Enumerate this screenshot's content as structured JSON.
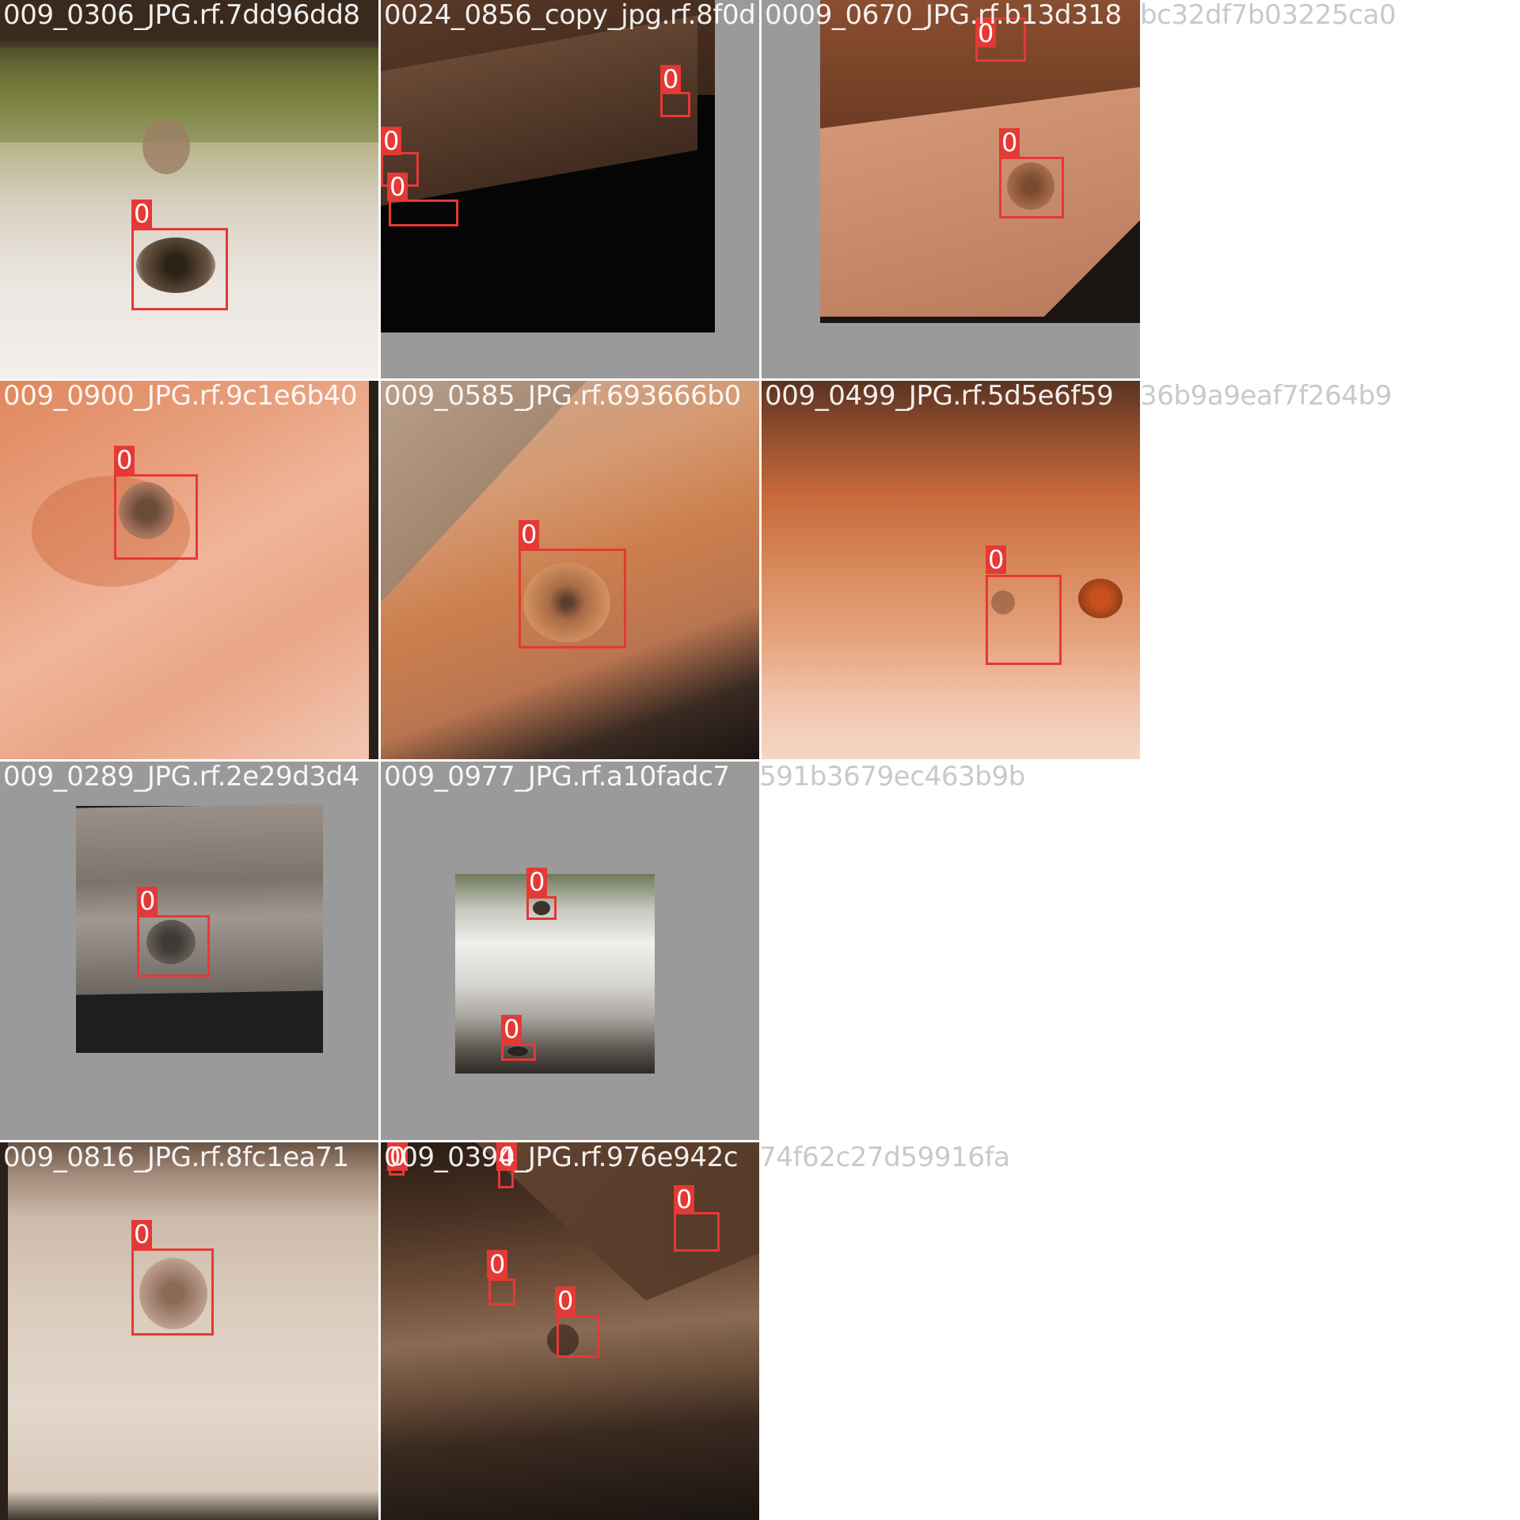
{
  "tiles": [
    {
      "title": "009_0306_JPG.rf.7dd96dd8",
      "labels": [
        "0"
      ]
    },
    {
      "title": "0024_0856_copy_jpg.rf.8f0d",
      "labels": [
        "0",
        "0",
        "0"
      ]
    },
    {
      "title": "0009_0670_JPG.rf.b13d318",
      "labels": [
        "0",
        "0"
      ]
    },
    {
      "title": "009_0900_JPG.rf.9c1e6b40",
      "labels": [
        "0"
      ]
    },
    {
      "title": "009_0585_JPG.rf.693666b0",
      "labels": [
        "0"
      ]
    },
    {
      "title": "009_0499_JPG.rf.5d5e6f59",
      "labels": [
        "0"
      ]
    },
    {
      "title": "009_0289_JPG.rf.2e29d3d4",
      "labels": [
        "0"
      ]
    },
    {
      "title": "009_0977_JPG.rf.a10fadc7",
      "labels": [
        "0",
        "0"
      ]
    },
    {
      "title": "009_0816_JPG.rf.8fc1ea71",
      "labels": [
        "0"
      ]
    },
    {
      "title": "009_0394_JPG.rf.976e942c",
      "labels": [
        "0",
        "0",
        "0",
        "0",
        "0"
      ]
    }
  ],
  "overflow_text": [
    "bc32df7b03225ca0",
    "36b9a9eaf7f264b9",
    "591b3679ec463b9b",
    "74f62c27d59916fa"
  ]
}
